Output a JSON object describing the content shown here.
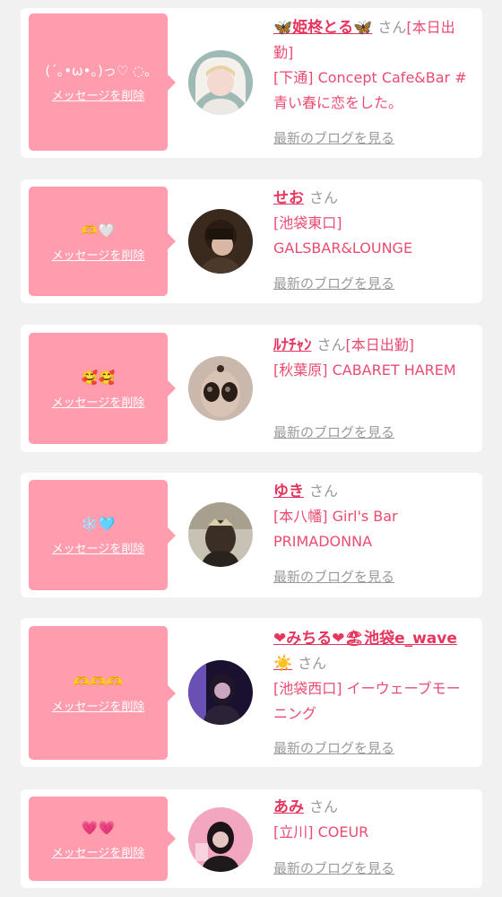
{
  "delete_label": "メッセージを削除",
  "blog_label": "最新のブログを見る",
  "san_label": "さん",
  "colors": {
    "bubble": "#ff9cae",
    "name": "#e5365f",
    "shop": "#e94b71",
    "muted": "#9a9a9a",
    "background": "#f1f1f1"
  },
  "messages": [
    {
      "message": "(´｡•ω•｡)っ♡ ◌｡",
      "name": "🦋姫柊とる🦋",
      "status": "[本日出勤]",
      "shop": "[下通] Concept Cafe&Bar #青い春に恋をした。"
    },
    {
      "message": "🫶🤍",
      "name": "せお",
      "status": "",
      "shop": "[池袋東口] GALSBAR&LOUNGE"
    },
    {
      "message": "🥰🥰",
      "name": "ﾙﾅﾁｬﾝ",
      "status": "[本日出勤]",
      "shop": "[秋葉原] CABARET HAREM"
    },
    {
      "message": "❄️🩵",
      "name": "ゆき",
      "status": "",
      "shop": "[本八幡] Girl's Bar PRIMADONNA"
    },
    {
      "message": "🫶🫶🫶",
      "name": "❤みちる❤🏖池袋e_wave☀️",
      "status": "",
      "shop": "[池袋西口] イーウェーブモーニング"
    },
    {
      "message": "💗💗",
      "name": "あみ",
      "status": "",
      "shop": "[立川] COEUR"
    }
  ]
}
